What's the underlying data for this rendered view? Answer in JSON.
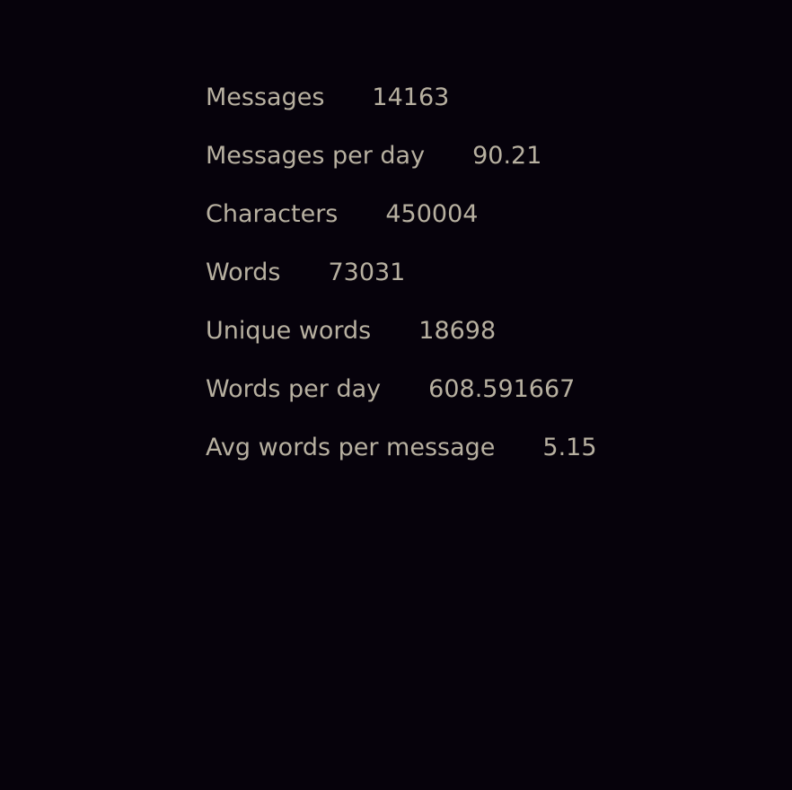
{
  "stats": [
    {
      "label": "Messages",
      "value": "14163"
    },
    {
      "label": "Messages per day",
      "value": "90.21"
    },
    {
      "label": "Characters",
      "value": "450004"
    },
    {
      "label": "Words",
      "value": "73031"
    },
    {
      "label": "Unique words",
      "value": "18698"
    },
    {
      "label": "Words per day",
      "value": "608.591667"
    },
    {
      "label": "Avg words per message",
      "value": "5.15"
    }
  ],
  "colors": {
    "background": "#06020b",
    "text": "#b7b0a0"
  }
}
